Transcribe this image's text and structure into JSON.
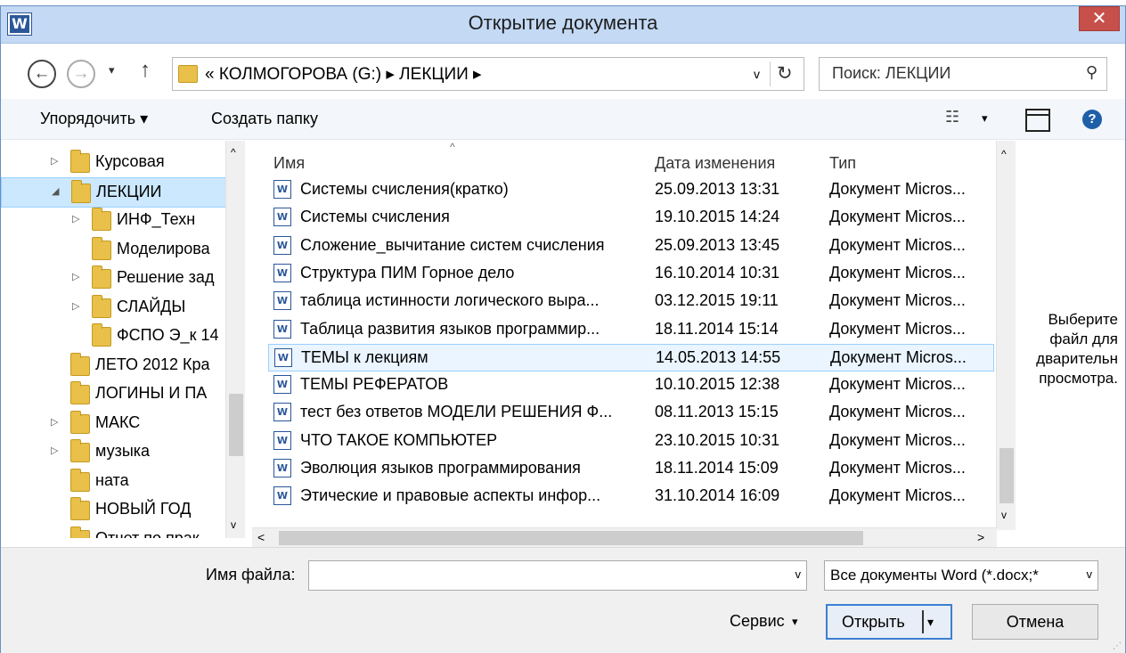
{
  "window": {
    "title": "Открытие документа",
    "app_icon_letter": "W",
    "close_glyph": "✕"
  },
  "address": {
    "back_glyph": "←",
    "forward_glyph": "→",
    "history_glyph": "▾",
    "up_glyph": "↑",
    "path": "« КОЛМОГОРОВА (G:)  ▸  ЛЕКЦИИ  ▸",
    "dropdown_glyph": "v",
    "refresh_glyph": "↻",
    "search_placeholder": "Поиск: ЛЕКЦИИ",
    "search_icon_glyph": "⚲"
  },
  "toolbar": {
    "organize_label": "Упорядочить ▾",
    "new_folder_label": "Создать папку",
    "view_glyph": "☷",
    "view_drop": "▾",
    "help_glyph": "?"
  },
  "nav": {
    "items": [
      {
        "label": "Курсовая",
        "expander": "▷",
        "indent": 1,
        "selected": false
      },
      {
        "label": "ЛЕКЦИИ",
        "expander": "◢",
        "indent": 1,
        "selected": true
      },
      {
        "label": "ИНФ_Техн",
        "expander": "▷",
        "indent": 2,
        "selected": false
      },
      {
        "label": "Моделирова",
        "expander": "",
        "indent": 2,
        "selected": false
      },
      {
        "label": "Решение зад",
        "expander": "▷",
        "indent": 2,
        "selected": false
      },
      {
        "label": "СЛАЙДЫ",
        "expander": "▷",
        "indent": 2,
        "selected": false
      },
      {
        "label": "ФСПО Э_к 14",
        "expander": "",
        "indent": 2,
        "selected": false
      },
      {
        "label": "ЛЕТО 2012 Кра",
        "expander": "",
        "indent": 1,
        "selected": false
      },
      {
        "label": "ЛОГИНЫ И ПА",
        "expander": "",
        "indent": 1,
        "selected": false
      },
      {
        "label": "МАКС",
        "expander": "▷",
        "indent": 1,
        "selected": false
      },
      {
        "label": "музыка",
        "expander": "▷",
        "indent": 1,
        "selected": false
      },
      {
        "label": "ната",
        "expander": "",
        "indent": 1,
        "selected": false
      },
      {
        "label": "НОВЫЙ ГОД",
        "expander": "",
        "indent": 1,
        "selected": false
      },
      {
        "label": "Отчет по прак",
        "expander": "",
        "indent": 1,
        "selected": false
      }
    ],
    "scroll_up": "^",
    "scroll_down": "v"
  },
  "columns": {
    "name": "Имя",
    "date": "Дата изменения",
    "type": "Тип",
    "sort_glyph": "^"
  },
  "files": [
    {
      "name": "Системы счисления(кратко)",
      "date": "25.09.2013 13:31",
      "type": "Документ Micros...",
      "selected": false
    },
    {
      "name": "Системы счисления",
      "date": "19.10.2015 14:24",
      "type": "Документ Micros...",
      "selected": false
    },
    {
      "name": "Сложение_вычитание систем счисления",
      "date": "25.09.2013 13:45",
      "type": "Документ Micros...",
      "selected": false
    },
    {
      "name": "Структура ПИМ Горное дело",
      "date": "16.10.2014 10:31",
      "type": "Документ Micros...",
      "selected": false
    },
    {
      "name": "таблица истинности логического выра...",
      "date": "03.12.2015 19:11",
      "type": "Документ Micros...",
      "selected": false
    },
    {
      "name": "Таблица развития языков программир...",
      "date": "18.11.2014 15:14",
      "type": "Документ Micros...",
      "selected": false
    },
    {
      "name": "ТЕМЫ к лекциям",
      "date": "14.05.2013 14:55",
      "type": "Документ Micros...",
      "selected": true
    },
    {
      "name": "ТЕМЫ РЕФЕРАТОВ",
      "date": "10.10.2015 12:38",
      "type": "Документ Micros...",
      "selected": false
    },
    {
      "name": "тест без ответов МОДЕЛИ РЕШЕНИЯ Ф...",
      "date": "08.11.2013 15:15",
      "type": "Документ Micros...",
      "selected": false
    },
    {
      "name": "ЧТО ТАКОЕ КОМПЬЮТЕР",
      "date": "23.10.2015 10:31",
      "type": "Документ Micros...",
      "selected": false
    },
    {
      "name": "Эволюция языков программирования",
      "date": "18.11.2014 15:09",
      "type": "Документ Micros...",
      "selected": false
    },
    {
      "name": "Этические и правовые аспекты инфор...",
      "date": "31.10.2014 16:09",
      "type": "Документ Micros...",
      "selected": false
    }
  ],
  "file_icon_label": "W",
  "list_scroll": {
    "up": "^",
    "down": "v",
    "left": "<",
    "right": ">"
  },
  "preview": {
    "text": "Выберите\nфайл для\nдварительн\nпросмотра."
  },
  "bottom": {
    "filename_label": "Имя файла:",
    "filename_value": "",
    "filename_drop": "v",
    "filter_value": "Все документы Word (*.docx;*",
    "filter_drop": "v",
    "tools_label": "Сервис",
    "tools_drop": "▾",
    "open_label": "Открыть",
    "open_drop": "▾",
    "cancel_label": "Отмена",
    "grip_glyph": "⋰"
  }
}
